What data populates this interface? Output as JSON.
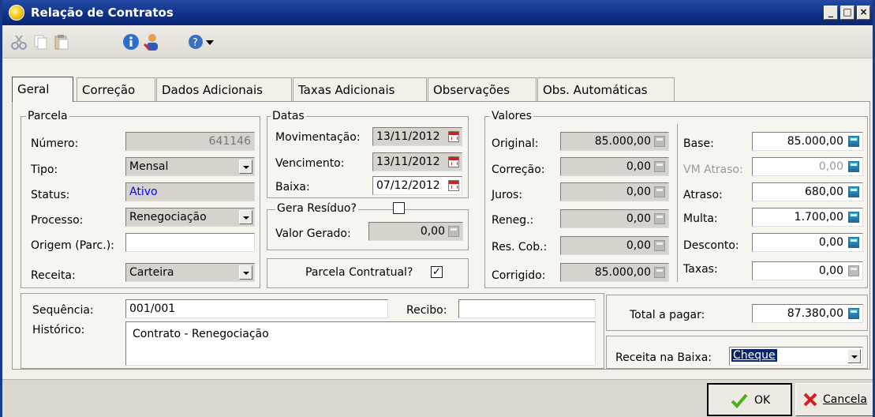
{
  "window": {
    "title": "Relação de Contratos"
  },
  "tabs": [
    {
      "label": "Geral"
    },
    {
      "label": "Correção"
    },
    {
      "label": "Dados Adicionais"
    },
    {
      "label": "Taxas Adicionais"
    },
    {
      "label": "Observações"
    },
    {
      "label": "Obs. Automáticas"
    }
  ],
  "parcela": {
    "legend": "Parcela",
    "numero_label": "Número:",
    "numero_value": "641146",
    "tipo_label": "Tipo:",
    "tipo_value": "Mensal",
    "status_label": "Status:",
    "status_value": "Ativo",
    "processo_label": "Processo:",
    "processo_value": "Renegociação",
    "origem_label": "Origem (Parc.):",
    "origem_value": "",
    "receita_label": "Receita:",
    "receita_value": "Carteira"
  },
  "datas": {
    "legend": "Datas",
    "movimentacao_label": "Movimentação:",
    "movimentacao_value": "13/11/2012",
    "vencimento_label": "Vencimento:",
    "vencimento_value": "13/11/2012",
    "baixa_label": "Baixa:",
    "baixa_value": "07/12/2012"
  },
  "residuo": {
    "legend": "Gera Resíduo?",
    "checked": false,
    "valor_label": "Valor Gerado:",
    "valor_value": "0,00"
  },
  "parcela_contratual": {
    "label": "Parcela Contratual?",
    "checked": true,
    "mark": "✓"
  },
  "valores": {
    "legend": "Valores",
    "original_label": "Original:",
    "original_value": "85.000,00",
    "correcao_label": "Correção:",
    "correcao_value": "0,00",
    "juros_label": "Juros:",
    "juros_value": "0,00",
    "reneg_label": "Reneg.:",
    "reneg_value": "0,00",
    "rescob_label": "Res. Cob.:",
    "rescob_value": "0,00",
    "corrigido_label": "Corrigido:",
    "corrigido_value": "85.000,00",
    "base_label": "Base:",
    "base_value": "85.000,00",
    "vmatraso_label": "VM Atraso:",
    "vmatraso_value": "0,00",
    "atraso_label": "Atraso:",
    "atraso_value": "680,00",
    "multa_label": "Multa:",
    "multa_value": "1.700,00",
    "desconto_label": "Desconto:",
    "desconto_value": "0,00",
    "taxas_label": "Taxas:",
    "taxas_value": "0,00"
  },
  "footer": {
    "sequencia_label": "Sequência:",
    "sequencia_value": "001/001",
    "recibo_label": "Recibo:",
    "recibo_value": "",
    "historico_label": "Histórico:",
    "historico_value": "Contrato - Renegociação",
    "total_label": "Total a pagar:",
    "total_value": "87.380,00",
    "receita_baixa_label": "Receita na Baixa:",
    "receita_baixa_value": "Cheque"
  },
  "buttons": {
    "ok": "OK",
    "cancel": "Cancela"
  },
  "colors": {
    "title_bar": "#0f2f86",
    "status_text": "#0000ff",
    "selection": "#0a246a"
  }
}
